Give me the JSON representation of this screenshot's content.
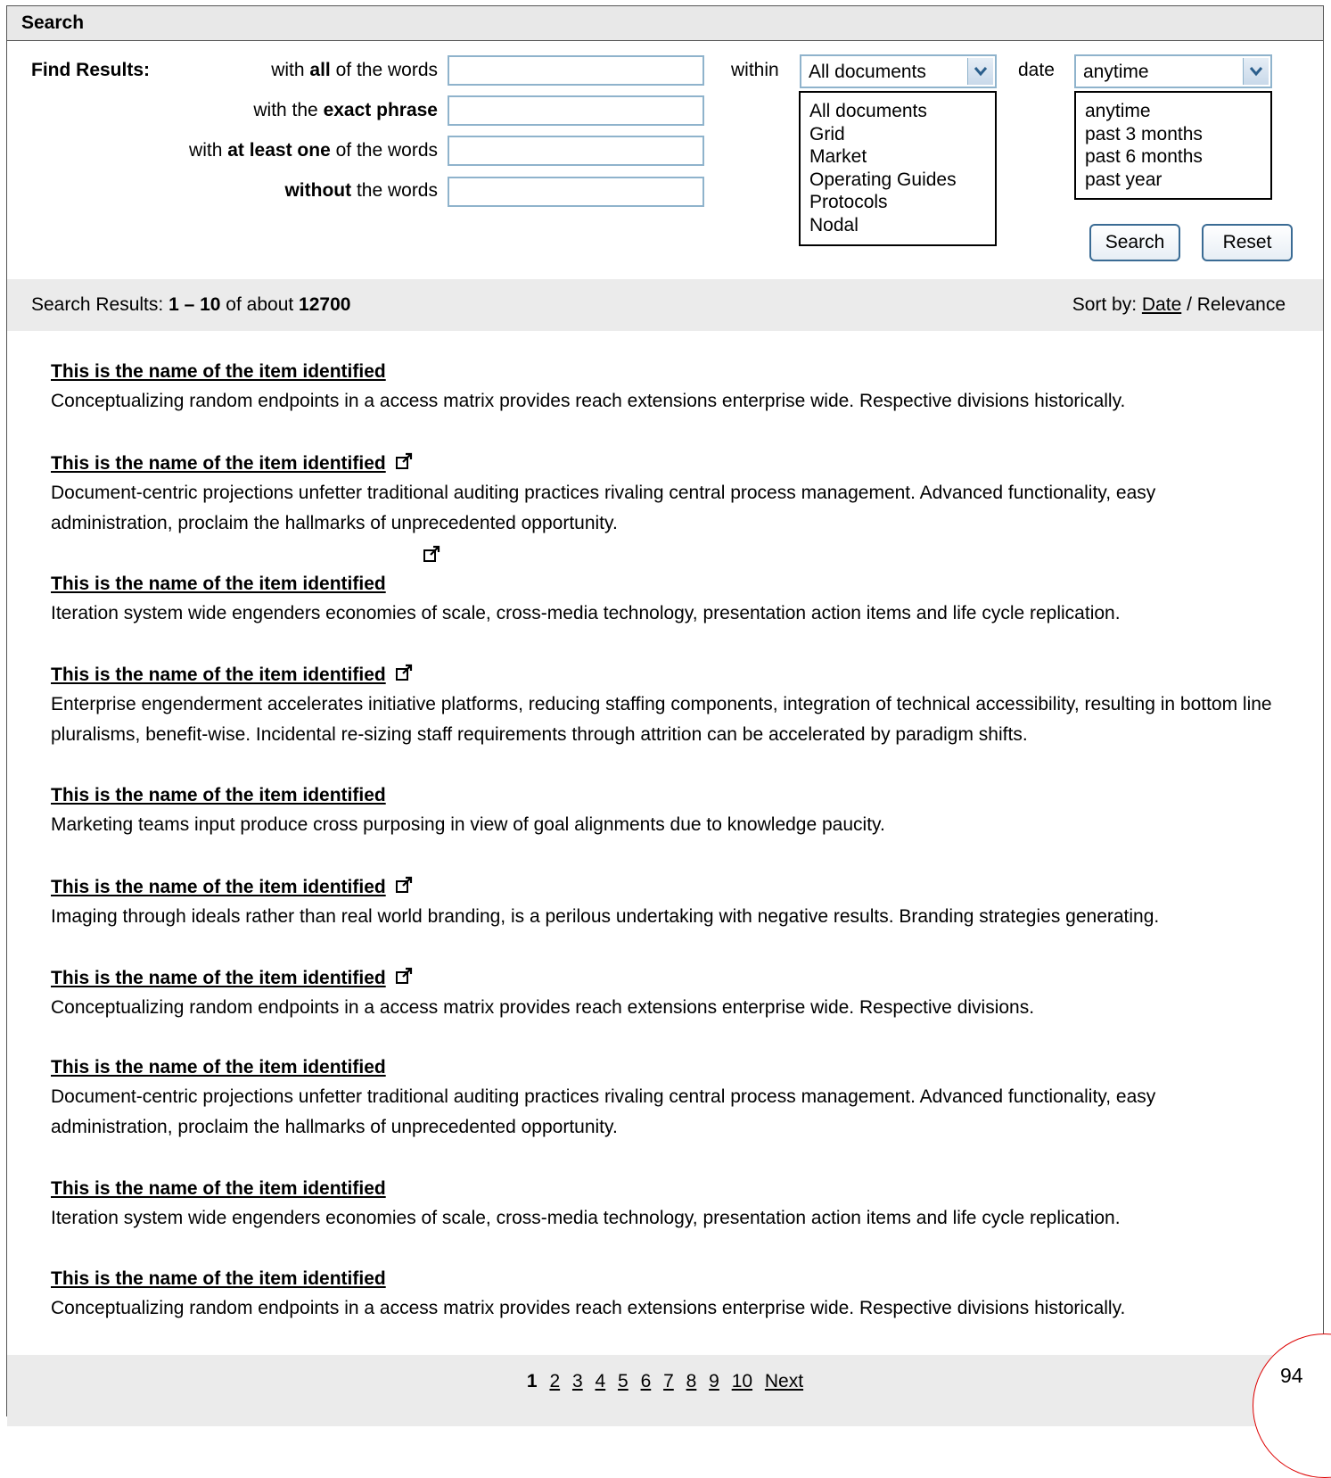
{
  "panel": {
    "title": "Search"
  },
  "find": {
    "label": "Find Results:",
    "criteria": [
      {
        "pre": "with ",
        "bold": "all",
        "post": " of the words",
        "value": ""
      },
      {
        "pre": "with the ",
        "bold": "exact phrase",
        "post": "",
        "value": ""
      },
      {
        "pre": "with ",
        "bold": "at least one",
        "post": " of the words",
        "value": ""
      },
      {
        "pre": "",
        "bold": "without",
        "post": " the words",
        "value": ""
      }
    ]
  },
  "within": {
    "label": "within",
    "selected": "All documents",
    "options": [
      "All documents",
      "Grid",
      "Market",
      "Operating Guides",
      "Protocols",
      "Nodal"
    ]
  },
  "date": {
    "label": "date",
    "selected": "anytime",
    "options": [
      "anytime",
      "past 3 months",
      "past 6 months",
      "past year"
    ]
  },
  "buttons": {
    "search": "Search",
    "reset": "Reset"
  },
  "results_bar": {
    "prefix": "Search Results: ",
    "range": "1 – 10",
    "of_about": " of about ",
    "total": "12700",
    "sort_label": "Sort by: ",
    "sort_date": "Date",
    "sort_sep": " / ",
    "sort_relevance": "Relevance"
  },
  "results": [
    {
      "title": "This is the name of the item identified",
      "external": false,
      "desc": "Conceptualizing random endpoints in a access matrix provides reach extensions enterprise wide. Respective divisions historically."
    },
    {
      "title": "This is the name of the item identified",
      "external": true,
      "desc": "Document-centric projections unfetter traditional auditing practices rivaling central process management. Advanced functionality, easy administration, proclaim the hallmarks of unprecedented opportunity."
    },
    {
      "title": "This is the name of the item identified",
      "external": false,
      "desc": "Iteration system wide engenders economies of scale, cross-media technology, presentation action items and life cycle replication."
    },
    {
      "title": "This is the name of the item identified",
      "external": true,
      "desc": "Enterprise engenderment accelerates initiative platforms, reducing staffing components, integration of technical accessibility, resulting in bottom line pluralisms, benefit-wise. Incidental re-sizing staff requirements through attrition can be accelerated by paradigm shifts."
    },
    {
      "title": "This is the name of the item identified",
      "external": false,
      "desc": "Marketing teams input produce cross purposing in view of goal alignments due to knowledge paucity."
    },
    {
      "title": "This is the name of the item identified",
      "external": true,
      "desc": "Imaging through ideals rather than real world branding, is a perilous undertaking with negative results. Branding strategies generating."
    },
    {
      "title": "This is the name of the item identified",
      "external": true,
      "desc": "Conceptualizing random endpoints in a access matrix provides reach extensions enterprise wide. Respective divisions."
    },
    {
      "title": "This is the name of the item identified",
      "external": false,
      "desc": "Document-centric projections unfetter traditional auditing practices rivaling central process management. Advanced functionality, easy administration, proclaim the hallmarks of unprecedented opportunity."
    },
    {
      "title": "This is the name of the item identified",
      "external": false,
      "desc": "Iteration system wide engenders economies of scale, cross-media technology, presentation action items and life cycle replication."
    },
    {
      "title": "This is the name of the item identified",
      "external": false,
      "desc": "Conceptualizing random endpoints in a access matrix provides reach extensions enterprise wide. Respective divisions historically."
    }
  ],
  "pager": {
    "current": "1",
    "pages": [
      "2",
      "3",
      "4",
      "5",
      "6",
      "7",
      "8",
      "9",
      "10"
    ],
    "next": "Next"
  },
  "page_number": "94",
  "icons": {
    "external": "external-link-icon",
    "dropdown": "chevron-down-icon"
  },
  "colors": {
    "input_border": "#8fb3cc",
    "button_border": "#3a6b94",
    "bar_bg": "#ebebeb",
    "page_marker": "#dd0000"
  }
}
